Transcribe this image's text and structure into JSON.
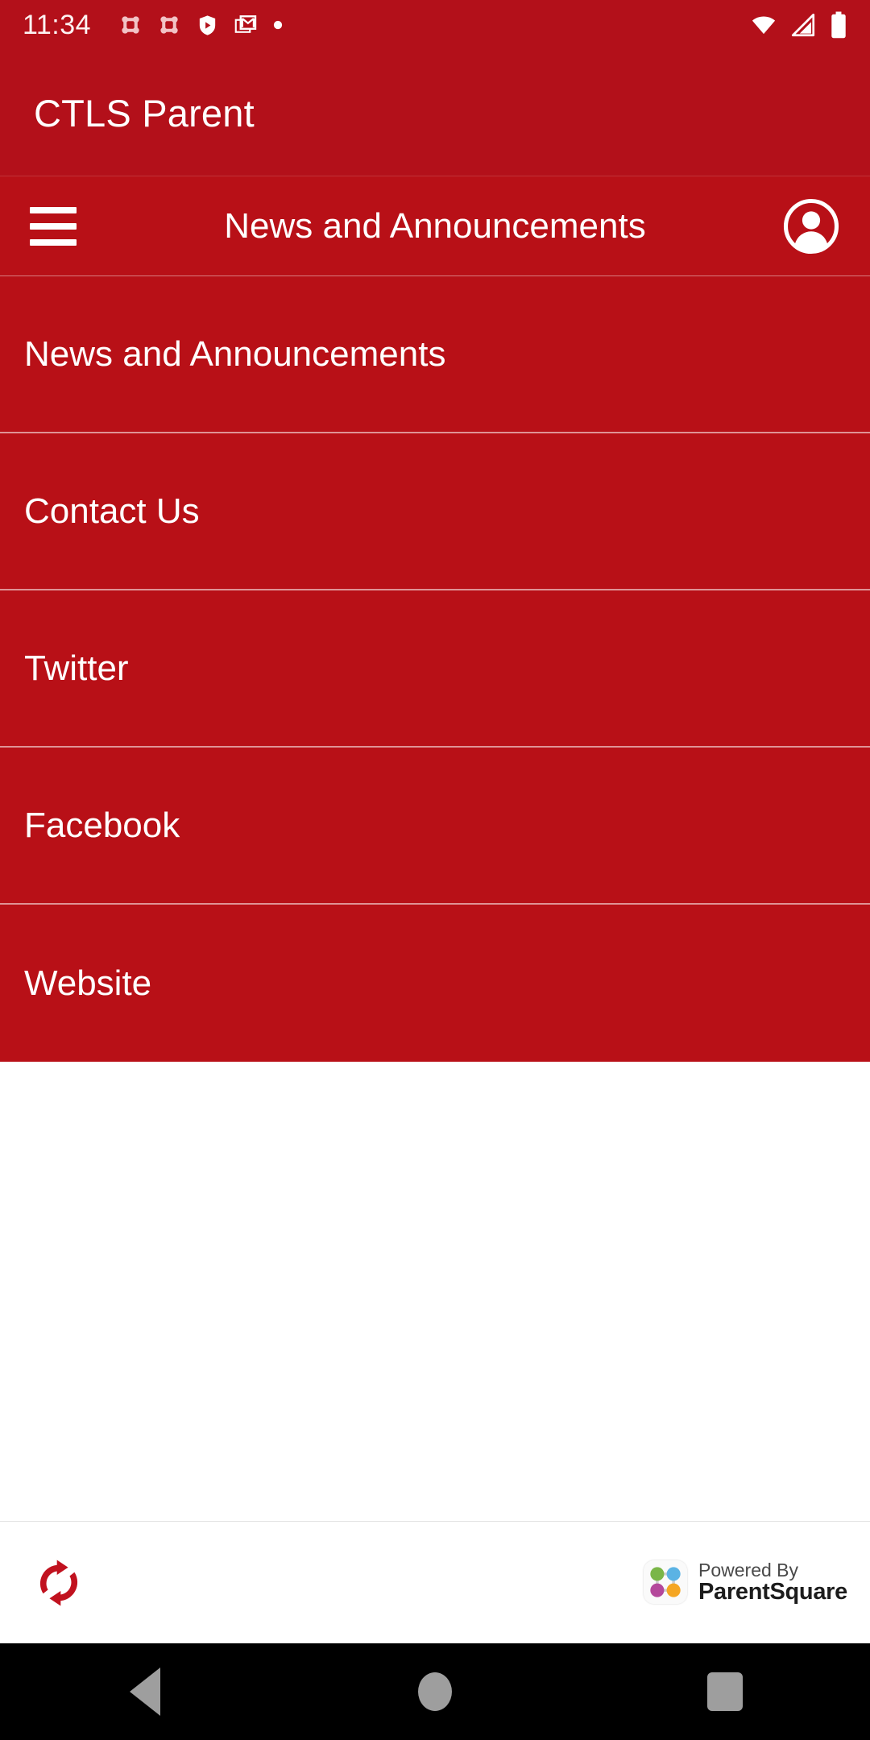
{
  "status_bar": {
    "time": "11:34",
    "left_icons": [
      "parentsquare-notification-icon",
      "parentsquare-notification-icon",
      "play-protect-shield-icon",
      "gmail-icon",
      "more-notifications-dot-icon"
    ],
    "right_icons": [
      "wifi-icon",
      "cellular-signal-icon",
      "battery-full-icon"
    ],
    "background_color": "#b3101a",
    "text_color": "#fdf2f2"
  },
  "appbar": {
    "title": "CTLS Parent",
    "background_color": "#b3101a"
  },
  "toolbar": {
    "menu_icon": "hamburger-menu-icon",
    "title": "News and Announcements",
    "account_icon": "account-circle-icon",
    "background_color": "#b81017"
  },
  "menu": {
    "items": [
      {
        "label": "News and Announcements"
      },
      {
        "label": "Contact Us"
      },
      {
        "label": "Twitter"
      },
      {
        "label": "Facebook"
      },
      {
        "label": "Website"
      }
    ],
    "background_color": "#b81017",
    "text_color": "#ffffff"
  },
  "content": {
    "body": ""
  },
  "footer": {
    "refresh_icon": "refresh-sync-icon",
    "refresh_color": "#c1121f",
    "powered_by_label": "Powered By",
    "brand_name": "ParentSquare",
    "logo_dot_colors": {
      "top_left": "#7ab648",
      "top_right": "#5bb3e4",
      "bottom_left": "#b4489b",
      "bottom_right": "#f5a623"
    }
  },
  "navbar": {
    "back_label": "back-button",
    "home_label": "home-button",
    "recents_label": "recents-button",
    "background_color": "#000000",
    "icon_color": "#9e9e9e"
  }
}
